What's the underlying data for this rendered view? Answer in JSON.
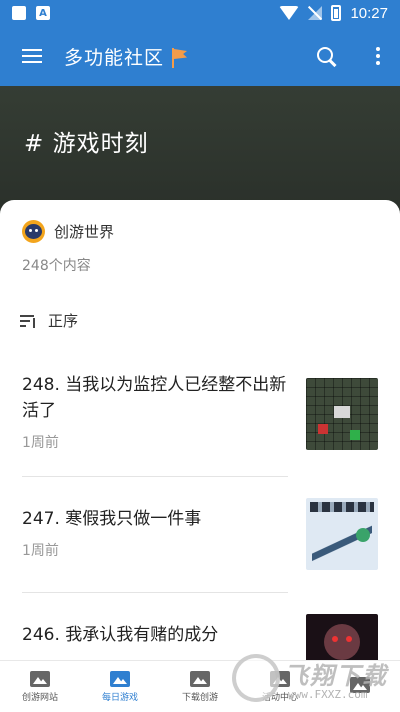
{
  "status_bar": {
    "time": "10:27",
    "app_icon_letter": "A"
  },
  "toolbar": {
    "title": "多功能社区",
    "flag_color": "#f39c4a"
  },
  "header": {
    "hashtag": "# 游戏时刻"
  },
  "collection": {
    "creator_name": "创游世界",
    "count_text": "248个内容",
    "sort_label": "正序"
  },
  "posts": [
    {
      "title": "248. 当我以为监控人已经整不出新活了",
      "time": "1周前"
    },
    {
      "title": "247. 寒假我只做一件事",
      "time": "1周前"
    },
    {
      "title": "246. 我承认我有赌的成分",
      "time": ""
    }
  ],
  "bottom_nav": [
    {
      "label": "创游网站",
      "active": false
    },
    {
      "label": "每日游戏",
      "active": true
    },
    {
      "label": "下载创游",
      "active": false
    },
    {
      "label": "活动中心",
      "active": false
    },
    {
      "label": "",
      "active": false
    }
  ],
  "watermark": {
    "text": "飞翔下载",
    "url": "www.FXXZ.com"
  },
  "colors": {
    "primary": "#2f7fd0",
    "background_band": "#2f3a30"
  }
}
